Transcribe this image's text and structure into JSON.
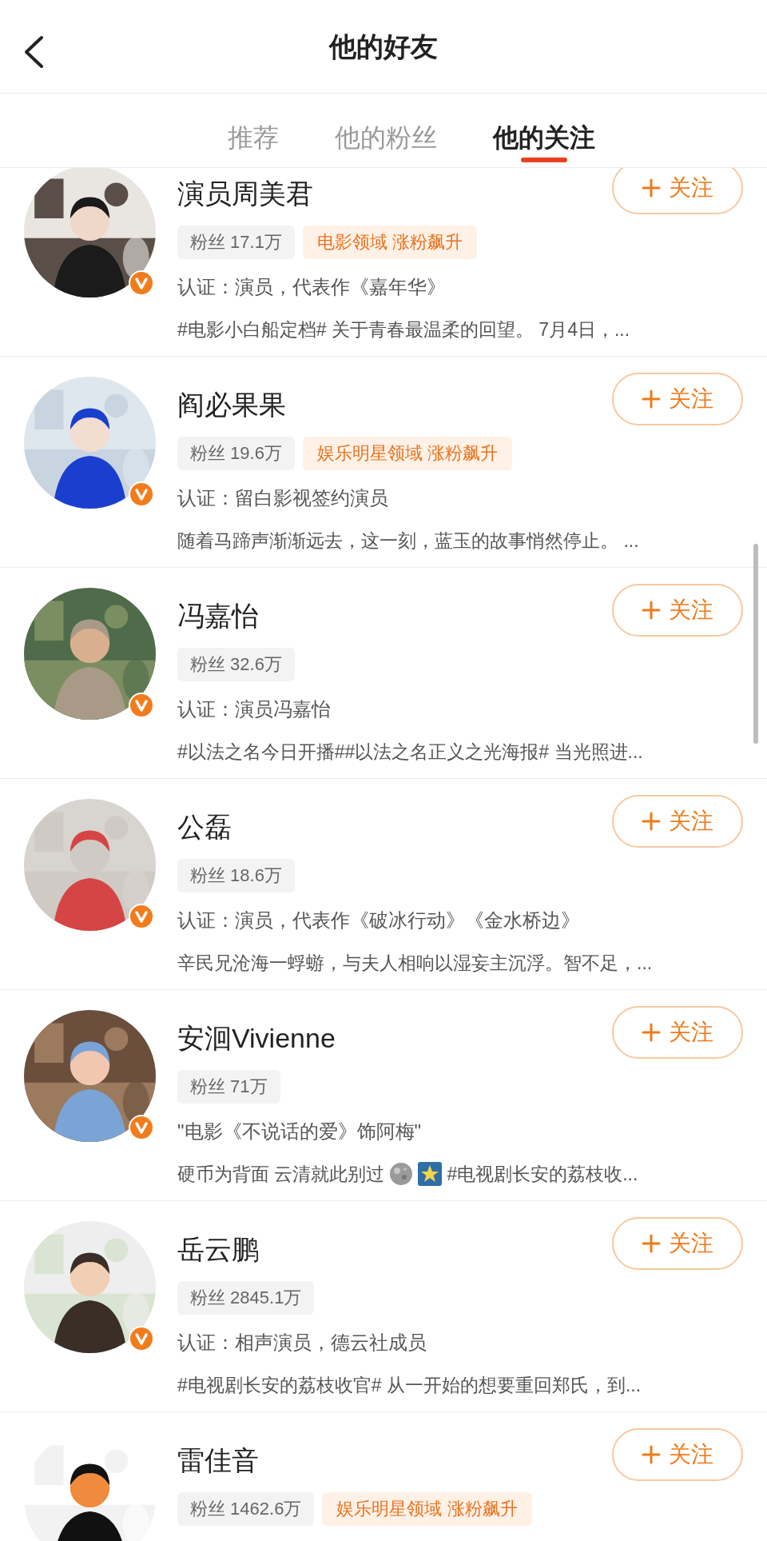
{
  "header": {
    "title": "他的好友"
  },
  "tabs": [
    {
      "label": "推荐",
      "selected": false
    },
    {
      "label": "他的粉丝",
      "selected": false
    },
    {
      "label": "他的关注",
      "selected": true
    }
  ],
  "users": [
    {
      "name": "演员周美君",
      "verified": true,
      "fans": "粉丝 17.1万",
      "tag": "电影领域 涨粉飙升",
      "cert": "认证：演员，代表作《嘉年华》",
      "desc": [
        {
          "kind": "text",
          "text": "#电影小白船定档# 关于青春最温柔的回望。 7月4日，..."
        }
      ],
      "follow_label": "关注"
    },
    {
      "name": "阎必果果",
      "verified": true,
      "fans": "粉丝 19.6万",
      "tag": "娱乐明星领域 涨粉飙升",
      "cert": "认证：留白影视签约演员",
      "desc": [
        {
          "kind": "text",
          "text": "随着马蹄声渐渐远去，这一刻，蓝玉的故事悄然停止。 ..."
        }
      ],
      "follow_label": "关注"
    },
    {
      "name": "冯嘉怡",
      "verified": true,
      "fans": "粉丝 32.6万",
      "cert": "认证：演员冯嘉怡",
      "desc": [
        {
          "kind": "text",
          "text": "#以法之名今日开播##以法之名正义之光海报# 当光照进..."
        }
      ],
      "follow_label": "关注"
    },
    {
      "name": "公磊",
      "verified": true,
      "fans": "粉丝 18.6万",
      "cert": "认证：演员，代表作《破冰行动》《金水桥边》",
      "desc": [
        {
          "kind": "text",
          "text": "辛民兄沧海一蜉蝣，与夫人相响以湿妄主沉浮。智不足，..."
        }
      ],
      "follow_label": "关注"
    },
    {
      "name": "安洄Vivienne",
      "verified": true,
      "fans": "粉丝 71万",
      "cert": "\"电影《不说话的爱》饰阿梅\"",
      "desc": [
        {
          "kind": "text",
          "text": "硬币为背面 云清就此别过"
        },
        {
          "kind": "moon"
        },
        {
          "kind": "star"
        },
        {
          "kind": "text",
          "text": "#电视剧长安的荔枝收..."
        }
      ],
      "follow_label": "关注"
    },
    {
      "name": "岳云鹏",
      "verified": true,
      "fans": "粉丝 2845.1万",
      "cert": "认证：相声演员，德云社成员",
      "desc": [
        {
          "kind": "text",
          "text": "#电视剧长安的荔枝收官# 从一开始的想要重回郑氏，到..."
        }
      ],
      "follow_label": "关注"
    },
    {
      "name": "雷佳音",
      "fans": "粉丝 1462.6万",
      "tag": "娱乐明星领域 涨粉飙升",
      "follow_label": "关注"
    }
  ]
}
